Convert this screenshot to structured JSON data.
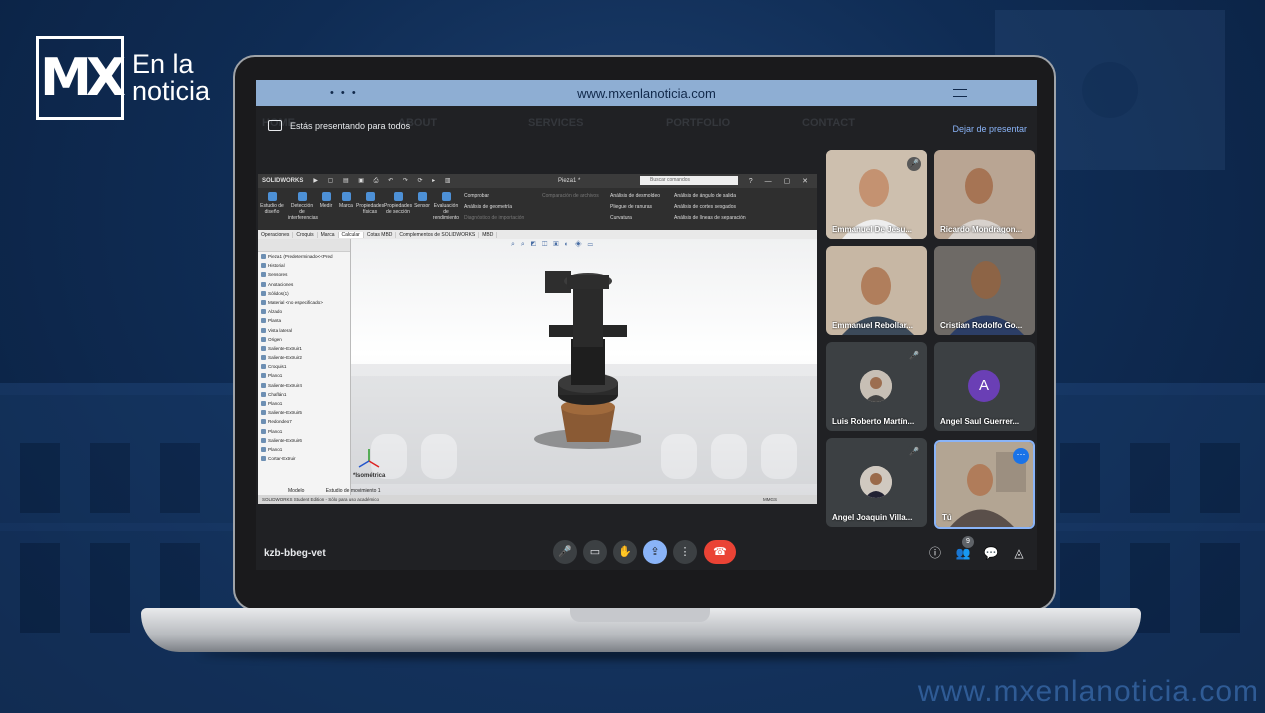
{
  "brand": {
    "logo_mark": "MX",
    "logo_line1": "En la",
    "logo_line2": "noticia",
    "watermark": "www.mxenlanoticia.com"
  },
  "browser": {
    "url": "www.mxenlanoticia.com",
    "dots": "• • •"
  },
  "site_nav": [
    "HOME",
    "ABOUT",
    "SERVICES",
    "PORTFOLIO",
    "CONTACT"
  ],
  "meet": {
    "presenting_text": "Estás presentando para todos",
    "stop_presenting": "Dejar de presentar",
    "meeting_code": "kzb-bbeg-vet",
    "participant_count": "9",
    "participants": [
      {
        "name": "Emmanuel De Jesu...",
        "muted": true
      },
      {
        "name": "Ricardo Mondragon...",
        "muted": false
      },
      {
        "name": "Emmanuel Rebollar...",
        "muted": false
      },
      {
        "name": "Cristian Rodolfo Go...",
        "muted": false
      },
      {
        "name": "Luis Roberto Martín...",
        "muted": true
      },
      {
        "name": "Angel Saul Guerrer...",
        "muted": false,
        "avatar_letter": "A"
      },
      {
        "name": "Angel Joaquin Villa...",
        "muted": true
      },
      {
        "name": "Tú",
        "muted": false
      }
    ],
    "colors": {
      "accent": "#8ab4f8",
      "end_call": "#ea4335",
      "avatar_purple": "#6a3fb5"
    }
  },
  "solidworks": {
    "brand": "SOLIDWORKS",
    "doc_title": "Pieza1 *",
    "search_placeholder": "Buscar comandos",
    "ribbon_buttons": [
      "Estudio de diseño",
      "Detección de interferencias",
      "Medir",
      "Marca",
      "Propiedades físicas",
      "Propiedades de sección",
      "Sensor",
      "Evaluación de rendimiento"
    ],
    "ribbon_list_1": [
      "Comprobar",
      "Análisis de geometría",
      "Diagnóstico de importación"
    ],
    "ribbon_list_1_dim": "Comparación de archivos",
    "ribbon_list_2": [
      "Análisis de desmoldeo",
      "Pliegue de ranuras",
      "Curvatura"
    ],
    "ribbon_list_3": [
      "Análisis de ángulo de salida",
      "Análisis de cortes sesgados",
      "Análisis de líneas de separación"
    ],
    "tabs": [
      "Operaciones",
      "Croquis",
      "Marca",
      "Calcular",
      "Cotas MBD",
      "Complementos de SOLIDWORKS",
      "MBD"
    ],
    "active_tab": "Calcular",
    "tree": [
      "Pieza1 (Predeterminado<<Pred",
      "Historial",
      "Sensores",
      "Anotaciones",
      "Sólidos(1)",
      "Material <no especificado>",
      "Alzado",
      "Planta",
      "Vista lateral",
      "Origen",
      "Saliente-Extruir1",
      "Saliente-Extruir2",
      "Croquis1",
      "Plano1",
      "Saliente-Extruir4",
      "Chaflán1",
      "Plano1",
      "Saliente-Extruir5",
      "Redondeo7",
      "Plano1",
      "Saliente-Extruir6",
      "Plano1",
      "Cortar-Extruir"
    ],
    "view_label": "*Isométrica",
    "bottom_tabs": [
      "Modelo",
      "Estudio de movimiento 1"
    ],
    "status": "SOLIDWORKS Student Edition - Sólo para uso académico",
    "units": "MMGS"
  }
}
